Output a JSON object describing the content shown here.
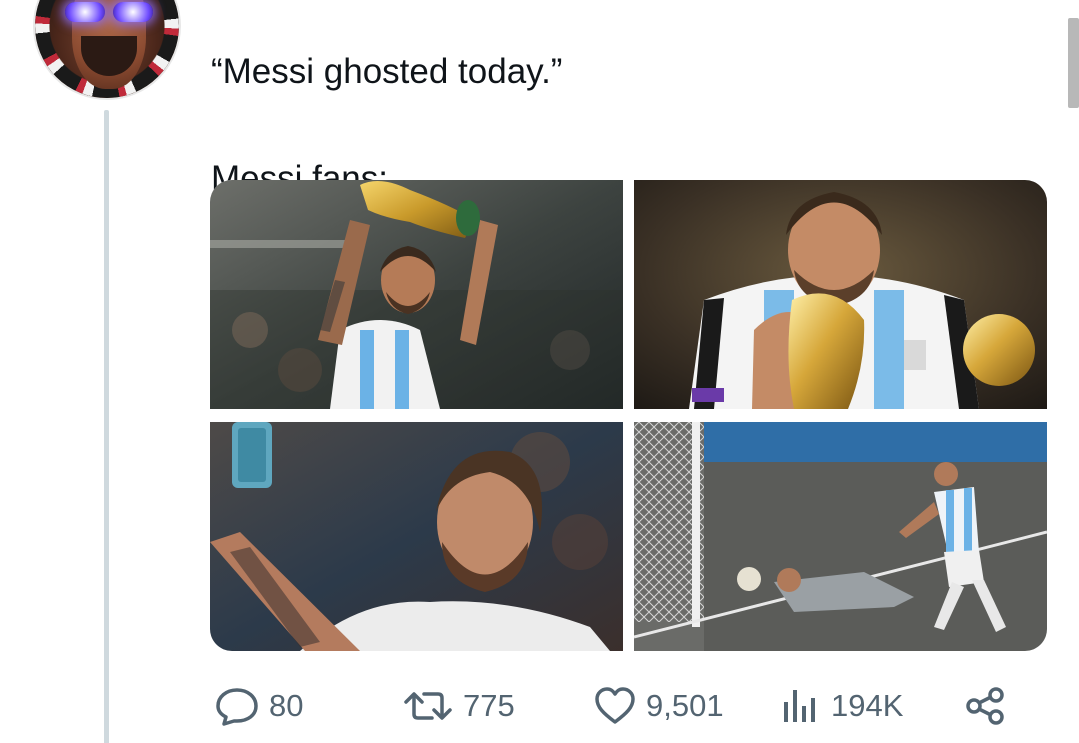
{
  "tweet": {
    "text_line1": "“Messi ghosted today.”",
    "text_line2": "Messi fans:"
  },
  "media": [
    {
      "icon": "trophy-lift-photo"
    },
    {
      "icon": "trophy-kiss-photo"
    },
    {
      "icon": "selfie-photo"
    },
    {
      "icon": "penalty-kick-photo"
    }
  ],
  "actions": {
    "reply_count": "80",
    "retweet_count": "775",
    "like_count": "9,501",
    "views_count": "194K"
  },
  "colors": {
    "text": "#0f1419",
    "secondary": "#536471",
    "thread_line": "#cfd9de"
  }
}
